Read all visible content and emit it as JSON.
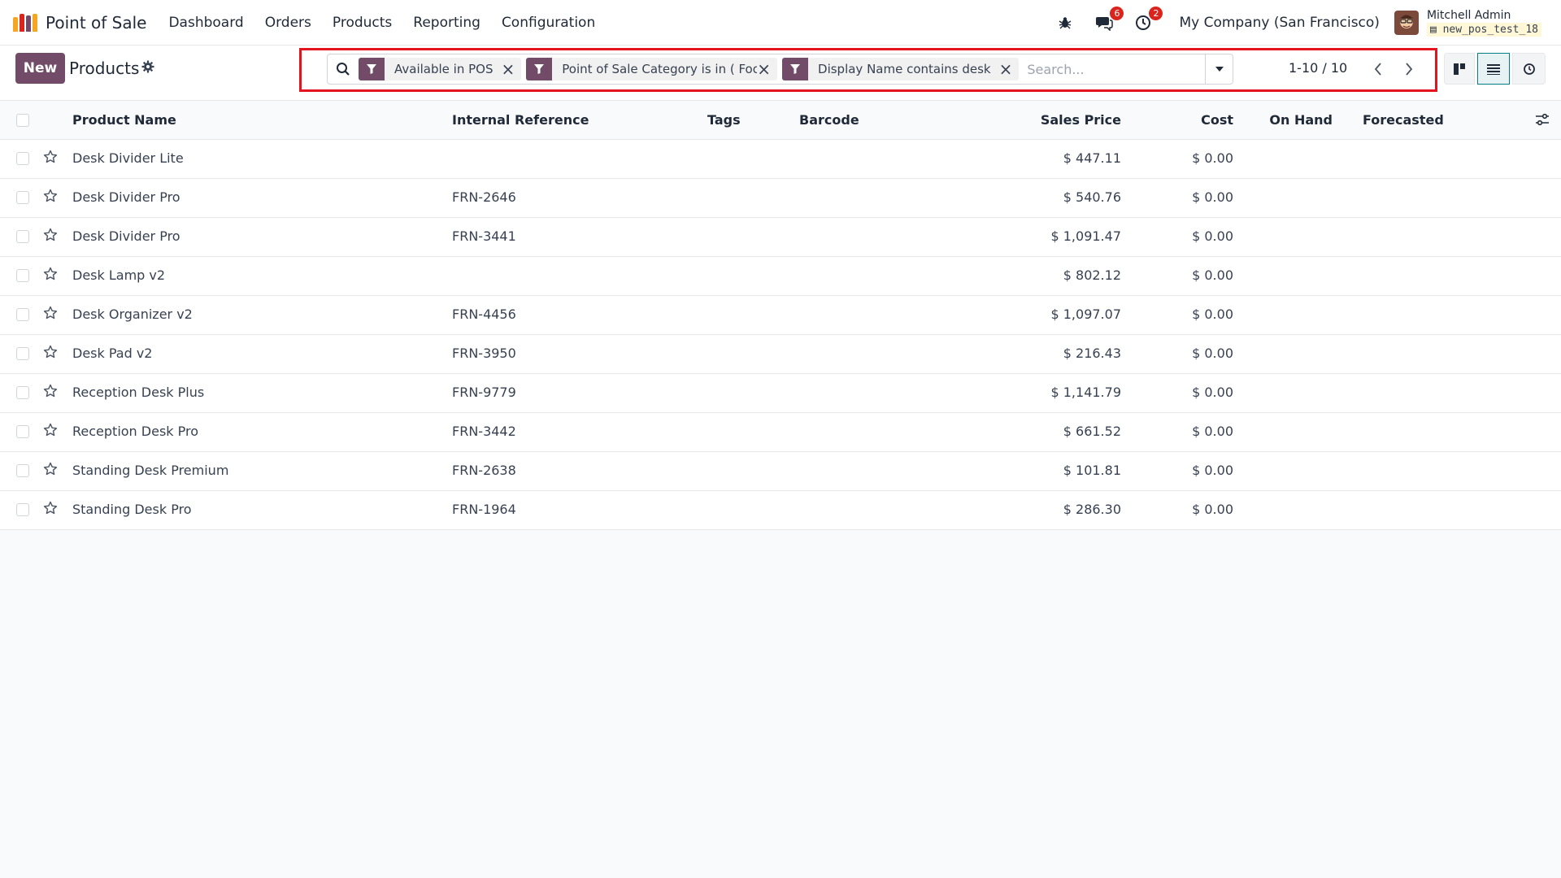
{
  "app": {
    "name": "Point of Sale",
    "logo_colors": [
      "#f5a623",
      "#d9251e",
      "#714b67",
      "#f5a623"
    ]
  },
  "menu": [
    "Dashboard",
    "Orders",
    "Products",
    "Reporting",
    "Configuration"
  ],
  "systray": {
    "debug_icon": "bug-icon",
    "messages_icon": "chat-icon",
    "messages_count": "6",
    "activities_icon": "clock-icon",
    "activities_count": "2",
    "company": "My Company (San Francisco)",
    "user_name": "Mitchell Admin",
    "database": "new_pos_test_18"
  },
  "control_panel": {
    "new_label": "New",
    "title": "Products",
    "facets": [
      {
        "label": "Available in POS"
      },
      {
        "label": "Point of Sale Category is in ( Food )"
      },
      {
        "label": "Display Name contains desk"
      }
    ],
    "search_placeholder": "Search...",
    "pager": "1-10 / 10",
    "views": [
      "kanban",
      "list",
      "activity"
    ],
    "active_view": "list"
  },
  "table": {
    "columns": [
      "Product Name",
      "Internal Reference",
      "Tags",
      "Barcode",
      "Sales Price",
      "Cost",
      "On Hand",
      "Forecasted"
    ],
    "rows": [
      {
        "name": "Desk Divider Lite",
        "ref": "",
        "price": "$ 447.11",
        "cost": "$ 0.00"
      },
      {
        "name": "Desk Divider Pro",
        "ref": "FRN-2646",
        "price": "$ 540.76",
        "cost": "$ 0.00"
      },
      {
        "name": "Desk Divider Pro",
        "ref": "FRN-3441",
        "price": "$ 1,091.47",
        "cost": "$ 0.00"
      },
      {
        "name": "Desk Lamp v2",
        "ref": "",
        "price": "$ 802.12",
        "cost": "$ 0.00"
      },
      {
        "name": "Desk Organizer v2",
        "ref": "FRN-4456",
        "price": "$ 1,097.07",
        "cost": "$ 0.00"
      },
      {
        "name": "Desk Pad v2",
        "ref": "FRN-3950",
        "price": "$ 216.43",
        "cost": "$ 0.00"
      },
      {
        "name": "Reception Desk Plus",
        "ref": "FRN-9779",
        "price": "$ 1,141.79",
        "cost": "$ 0.00"
      },
      {
        "name": "Reception Desk Pro",
        "ref": "FRN-3442",
        "price": "$ 661.52",
        "cost": "$ 0.00"
      },
      {
        "name": "Standing Desk Premium",
        "ref": "FRN-2638",
        "price": "$ 101.81",
        "cost": "$ 0.00"
      },
      {
        "name": "Standing Desk Pro",
        "ref": "FRN-1964",
        "price": "$ 286.30",
        "cost": "$ 0.00"
      }
    ]
  }
}
